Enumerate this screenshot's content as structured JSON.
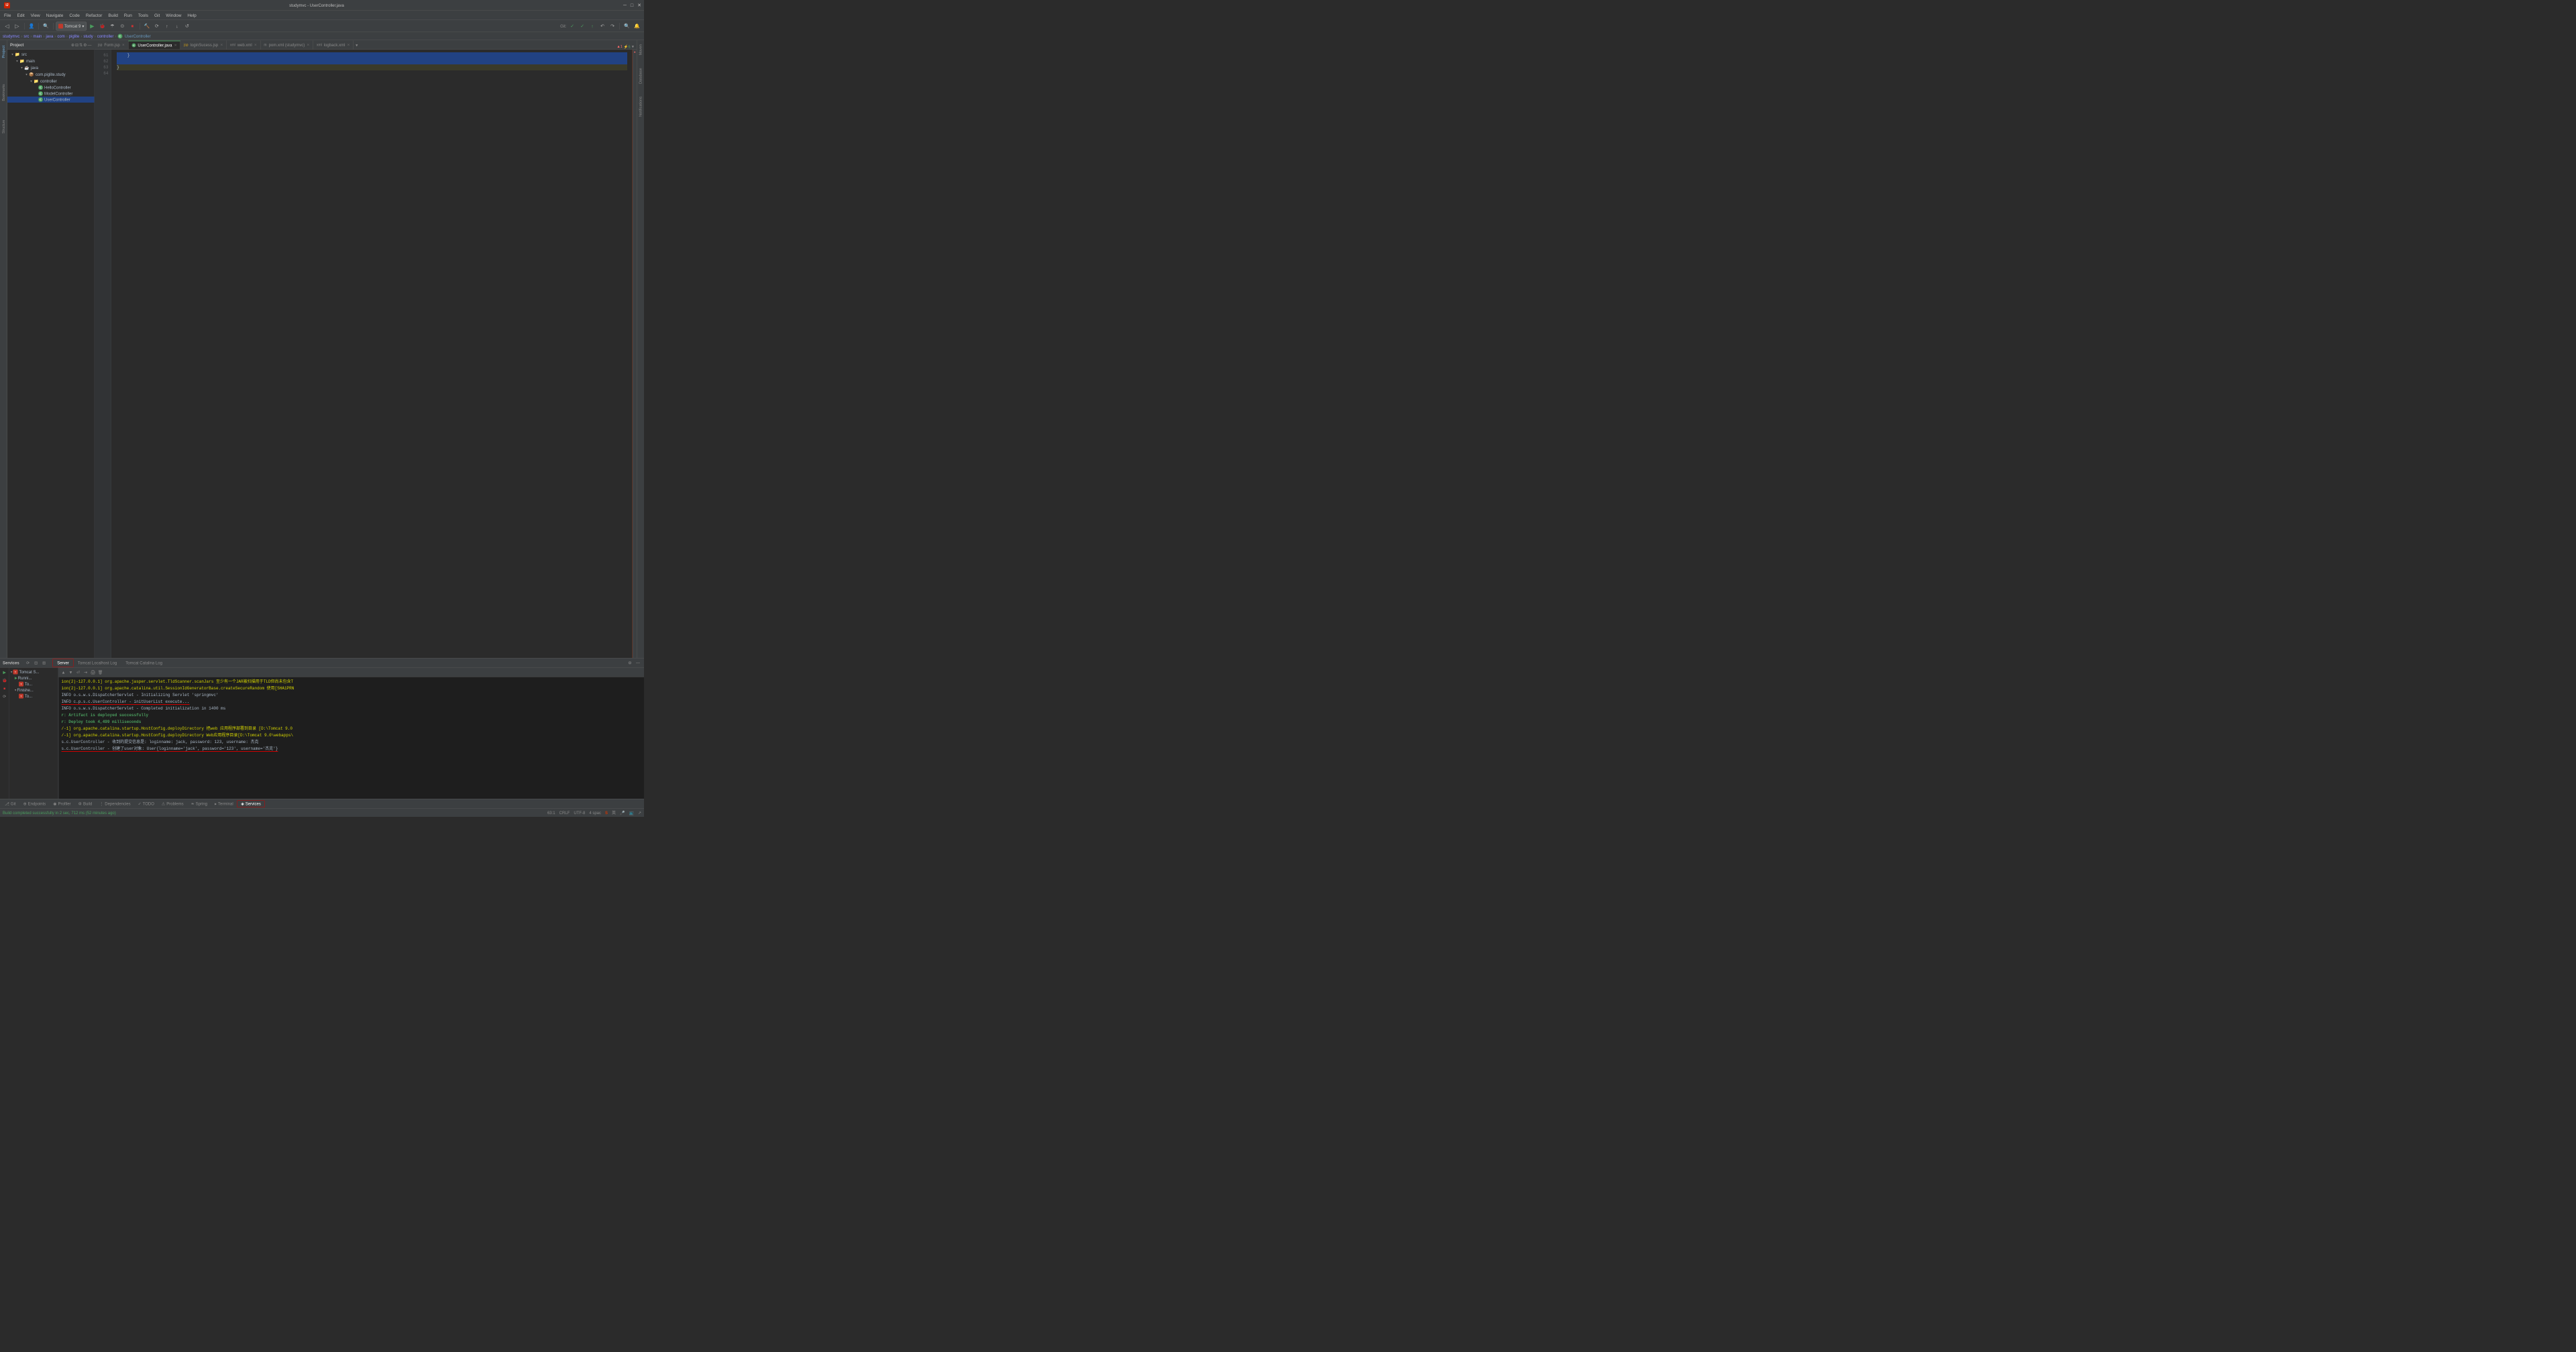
{
  "window": {
    "title": "studymvc - UserController.java",
    "controls": [
      "─",
      "□",
      "✕"
    ]
  },
  "menu": {
    "items": [
      "File",
      "Edit",
      "View",
      "Navigate",
      "Code",
      "Refactor",
      "Build",
      "Run",
      "Tools",
      "Git",
      "Window",
      "Help"
    ]
  },
  "toolbar": {
    "tomcat": {
      "label": "Tomcat 9",
      "dropdown_arrow": "▾"
    },
    "git_label": "Git:"
  },
  "breadcrumb": {
    "items": [
      "studymvc",
      "src",
      "main",
      "java",
      "com",
      "piglite",
      "study",
      "controller",
      "UserController"
    ]
  },
  "tabs": {
    "items": [
      {
        "label": "Form.jsp",
        "icon": "jsp",
        "active": false
      },
      {
        "label": "UserController.java",
        "icon": "c",
        "active": true
      },
      {
        "label": "loginSucess.jsp",
        "icon": "jsp",
        "active": false
      },
      {
        "label": "web.xml",
        "icon": "xml",
        "active": false
      },
      {
        "label": "pom.xml (studymvc)",
        "icon": "m",
        "active": false
      },
      {
        "label": "logback.xml",
        "icon": "xml",
        "active": false
      }
    ]
  },
  "editor": {
    "lines": [
      {
        "num": "61",
        "content": "    }"
      },
      {
        "num": "62",
        "content": ""
      },
      {
        "num": "63",
        "content": "}"
      },
      {
        "num": "64",
        "content": ""
      }
    ],
    "error_indicator": "▲1 ⚡6"
  },
  "file_tree": {
    "items": [
      {
        "level": 0,
        "type": "folder",
        "expanded": true,
        "label": "src"
      },
      {
        "level": 1,
        "type": "folder",
        "expanded": true,
        "label": "main"
      },
      {
        "level": 2,
        "type": "folder",
        "expanded": true,
        "label": "java"
      },
      {
        "level": 3,
        "type": "package",
        "expanded": true,
        "label": "com.piglite.study"
      },
      {
        "level": 4,
        "type": "folder",
        "expanded": true,
        "label": "controller"
      },
      {
        "level": 5,
        "type": "class",
        "label": "HelloController"
      },
      {
        "level": 5,
        "type": "class",
        "label": "ModelController"
      },
      {
        "level": 5,
        "type": "class",
        "label": "UserController",
        "selected": true
      }
    ]
  },
  "services": {
    "title": "Services",
    "tabs": [
      "Server",
      "Tomcat Localhost Log",
      "Tomcat Catalina Log"
    ],
    "active_tab": "Server",
    "tree_items": [
      {
        "label": "Tomcat S...",
        "level": 0,
        "expanded": true
      },
      {
        "label": "Runni...",
        "level": 1,
        "expanded": true
      },
      {
        "label": "To...",
        "level": 2
      },
      {
        "label": "Finishe...",
        "level": 1,
        "expanded": true
      },
      {
        "label": "To...",
        "level": 2
      }
    ],
    "log_lines": [
      {
        "type": "warn",
        "text": "ion(2)-127.0.0.1] org.apache.jasper.servlet.TldScanner.scanJars 至少有一个JAR被扫描用于TLD但尚未包含T"
      },
      {
        "type": "warn",
        "text": "ion(2)-127.0.0.1] org.apache.catalina.util.SessionIdGeneratorBase.createSecureRandom 使用[SHA1PRN"
      },
      {
        "type": "info",
        "text": "INFO  o.s.w.s.DispatcherServlet - Initializing Servlet 'springmvc'"
      },
      {
        "type": "info-red-bold",
        "text": "INFO  c.p.s.c.UserController - initUserList execute..."
      },
      {
        "type": "info",
        "text": "INFO  o.s.w.s.DispatcherServlet - Completed initialization in 1400 ms"
      },
      {
        "type": "success-bold",
        "text": "r: Artifact is deployed successfully"
      },
      {
        "type": "success-bold",
        "text": "r: Deploy took 4,499 milliseconds"
      },
      {
        "type": "warn",
        "text": "/-1] org.apache.catalina.startup.HostConfig.deployDirectory 把web 应用程序部署到目录 [D:\\Tomcat 9.0"
      },
      {
        "type": "warn",
        "text": "/-1] org.apache.catalina.startup.HostConfig.deployDirectory Web应用程序目录[D:\\Tomcat 9.0\\webapps\\"
      },
      {
        "type": "info",
        "text": "s.c.UserController - 收到的提交信息是: loginname: jack, password: 123, username: 杰克"
      },
      {
        "type": "info-red-underline",
        "text": "s.c.UserController - 创建了user对象: User{loginname='jack', password='123', username='杰克'}"
      }
    ]
  },
  "bottom_tabs": [
    {
      "label": "Git",
      "icon": "⎇",
      "active": false
    },
    {
      "label": "Endpoints",
      "icon": "⊕",
      "active": false
    },
    {
      "label": "Profiler",
      "icon": "◉",
      "active": false
    },
    {
      "label": "Build",
      "icon": "⚙",
      "active": false
    },
    {
      "label": "Dependencies",
      "icon": "⋮",
      "active": false
    },
    {
      "label": "TODO",
      "icon": "✓",
      "active": false
    },
    {
      "label": "Problems",
      "icon": "⚠",
      "active": false
    },
    {
      "label": "Spring",
      "icon": "❧",
      "active": false
    },
    {
      "label": "Terminal",
      "icon": "▸",
      "active": false
    },
    {
      "label": "Services",
      "icon": "◈",
      "active": true
    }
  ],
  "status_bar": {
    "message": "Build completed successfully in 2 sec, 712 ms (52 minutes ago)",
    "position": "63:1",
    "line_ending": "CRLF",
    "encoding": "UTF-8",
    "indent": "4 spac",
    "lang": "英"
  },
  "right_panels": [
    "Maven",
    "Database",
    "Notifications"
  ]
}
